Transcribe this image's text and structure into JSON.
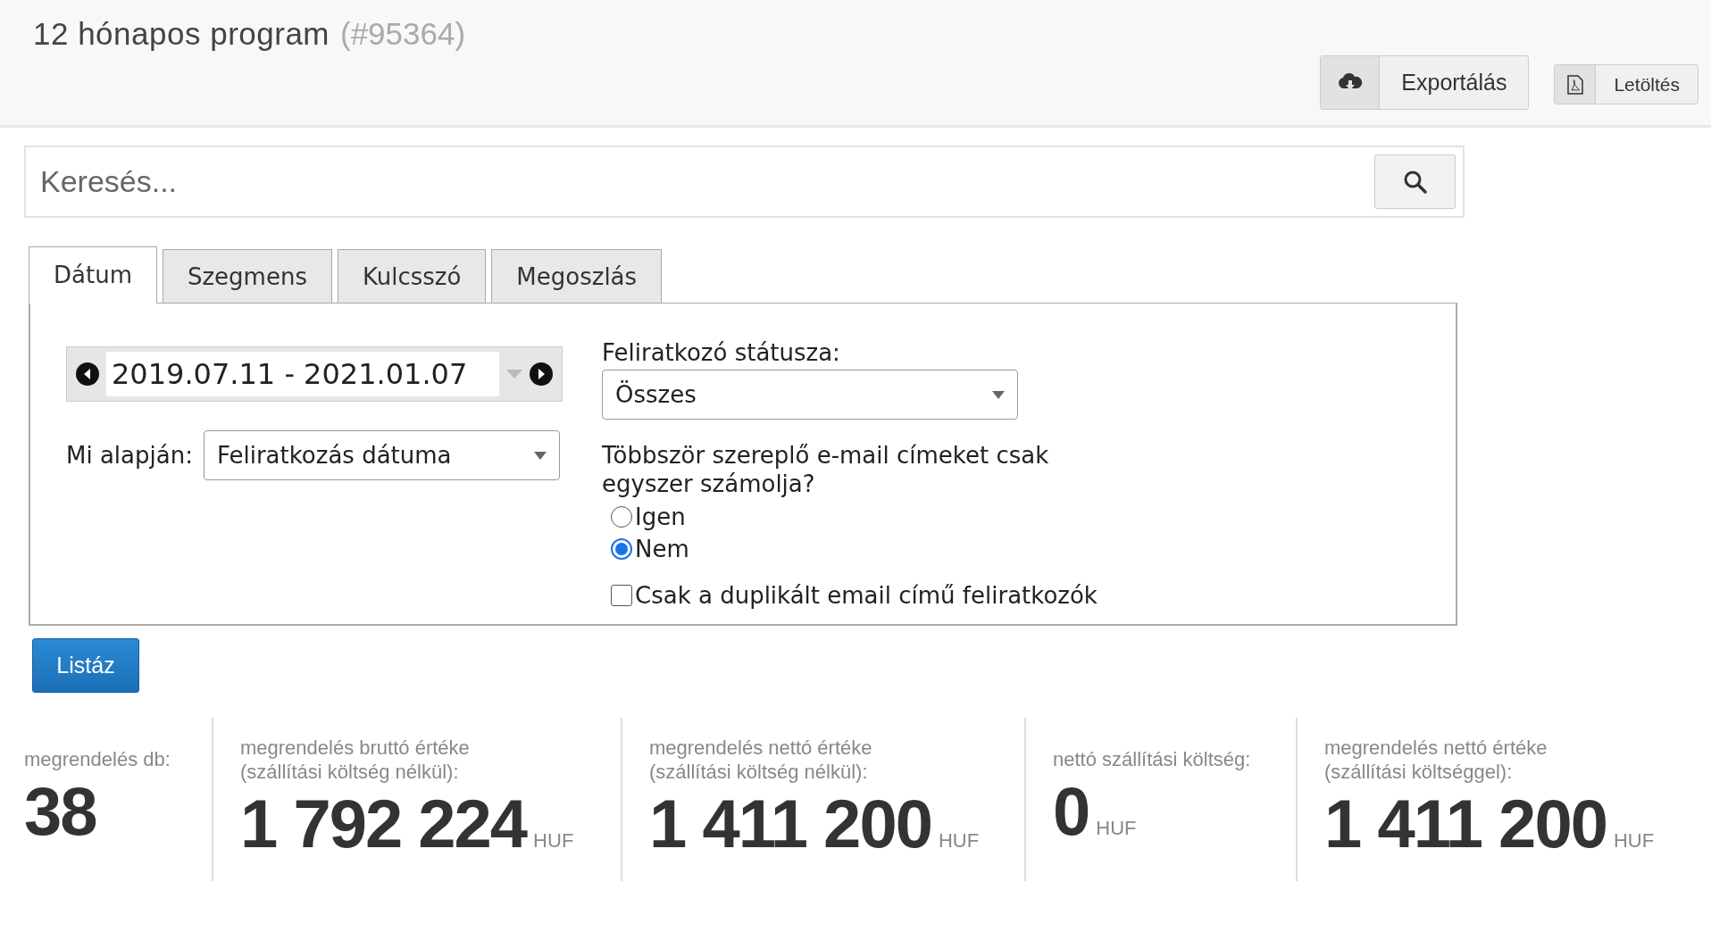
{
  "header": {
    "title": "12 hónapos program",
    "id_label": "(#95364)",
    "buttons": [
      {
        "kind": "export",
        "label": "Exportálás"
      },
      {
        "kind": "pdf",
        "label": "Letöltés"
      }
    ]
  },
  "search": {
    "placeholder": "Keresés..."
  },
  "tabs": [
    {
      "label": "Dátum",
      "selected": true
    },
    {
      "label": "Szegmens",
      "selected": false
    },
    {
      "label": "Kulcsszó",
      "selected": false
    },
    {
      "label": "Megoszlás",
      "selected": false
    }
  ],
  "filters": {
    "date_range": "2019.07.11 - 2021.01.07",
    "basis_label": "Mi alapján:",
    "basis_value": "Feliratkozás dátuma",
    "status_label": "Feliratkozó státusza:",
    "status_value": "Összes",
    "question": "Többször szereplő e-mail címeket csak egyszer számolja?",
    "options": [
      {
        "label": "Igen",
        "selected": false
      },
      {
        "label": "Nem",
        "selected": true
      }
    ],
    "duplicate_only": {
      "label": "Csak a duplikált email című feliratkozók",
      "checked": false
    }
  },
  "submit": "Listáz",
  "stats": [
    {
      "label": "megrendelés db:",
      "value": "38"
    },
    {
      "label": "megrendelés bruttó értéke (szállítási költség nélkül):",
      "value": "1 792 224",
      "unit": "HUF"
    },
    {
      "label": "megrendelés nettó értéke (szállítási költség nélkül):",
      "value": "1 411 200",
      "unit": "HUF"
    },
    {
      "label": "nettó szállítási költség:",
      "value": "0",
      "unit": "HUF"
    },
    {
      "label": "megrendelés nettó értéke (szállítási költséggel):",
      "value": "1 411 200",
      "unit": "HUF"
    }
  ]
}
